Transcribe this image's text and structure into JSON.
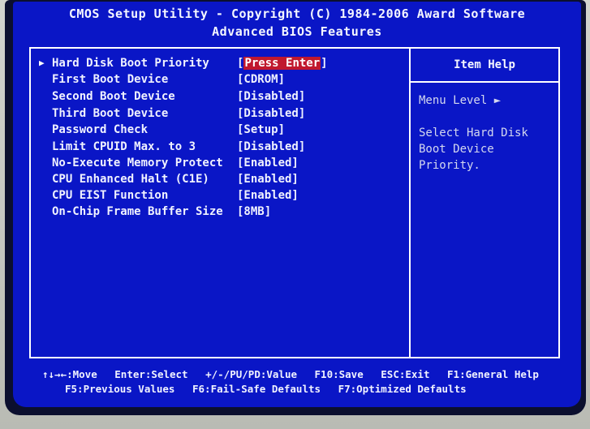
{
  "header": {
    "title": "CMOS Setup Utility - Copyright (C) 1984-2006 Award Software",
    "subtitle": "Advanced BIOS Features"
  },
  "settings": [
    {
      "label": "Hard Disk Boot Priority",
      "value": "Press Enter",
      "selected": true
    },
    {
      "label": "First Boot Device",
      "value": "[CDROM]"
    },
    {
      "label": "Second Boot Device",
      "value": "[Disabled]"
    },
    {
      "label": "Third Boot Device",
      "value": "[Disabled]"
    },
    {
      "label": "Password Check",
      "value": "[Setup]"
    },
    {
      "label": "Limit CPUID Max. to 3",
      "value": "[Disabled]"
    },
    {
      "label": "No-Execute Memory Protect",
      "value": "[Enabled]"
    },
    {
      "label": "CPU Enhanced Halt (C1E)",
      "value": "[Enabled]"
    },
    {
      "label": "CPU EIST Function",
      "value": "[Enabled]"
    },
    {
      "label": "On-Chip Frame Buffer Size",
      "value": "[8MB]"
    }
  ],
  "help": {
    "title": "Item Help",
    "menu_level": "Menu Level  ►",
    "text": "Select Hard Disk Boot Device Priority."
  },
  "footer": {
    "line1": [
      "↑↓→←:Move",
      "Enter:Select",
      "+/-/PU/PD:Value",
      "F10:Save",
      "ESC:Exit",
      "F1:General Help"
    ],
    "line2": [
      "F5:Previous Values",
      "F6:Fail-Safe Defaults",
      "F7:Optimized Defaults"
    ]
  },
  "colors": {
    "screen_bg": "#0a16c6",
    "highlight": "#c0182e",
    "text": "#f0f2ff"
  }
}
